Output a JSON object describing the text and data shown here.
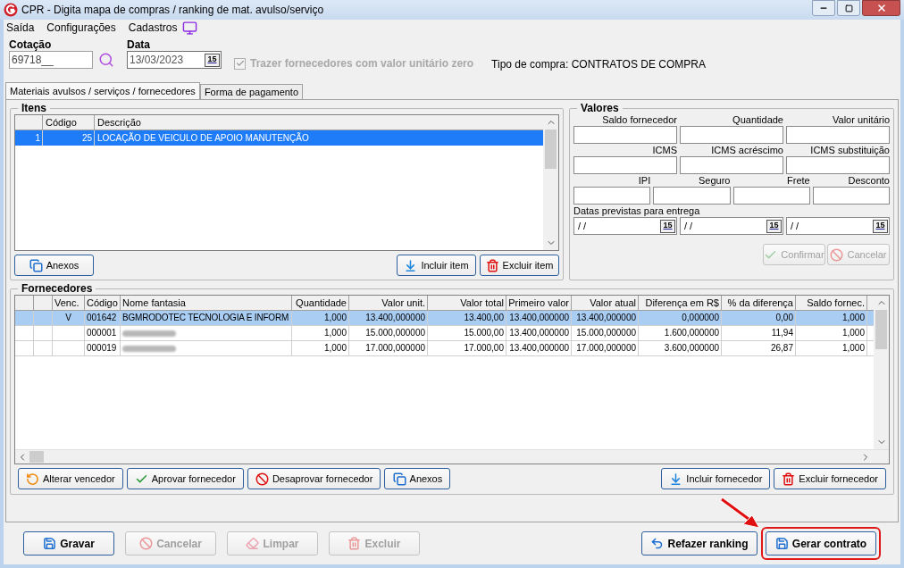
{
  "window": {
    "title": "CPR - Digita mapa de compras / ranking de mat. avulso/serviço"
  },
  "menu": [
    {
      "label": "Saída"
    },
    {
      "label": "Configurações"
    },
    {
      "label": "Cadastros"
    }
  ],
  "cotacao": {
    "label": "Cotação",
    "value": "69718__"
  },
  "data": {
    "label": "Data",
    "value": "13/03/2023",
    "calendar": "15"
  },
  "zero_option": {
    "label": "Trazer fornecedores com valor unitário zero",
    "checked": true,
    "disabled": true
  },
  "tipo_compra": "Tipo de compra: CONTRATOS DE COMPRA",
  "tabs": [
    {
      "label": "Materiais avulsos / serviços / fornecedores",
      "selected": true
    },
    {
      "label": "Forma de pagamento",
      "selected": false
    }
  ],
  "itens": {
    "title": "Itens",
    "columns": [
      "Código",
      "Descrição"
    ],
    "rows": [
      {
        "index": "1",
        "codigo": "25",
        "descricao": "LOCAÇÃO DE VEICULO DE APOIO MANUTENÇÃO",
        "selected": true
      }
    ],
    "buttons_left": [
      {
        "label": "Anexos",
        "kind": "attach",
        "disabled": false
      }
    ],
    "buttons_right": [
      {
        "label": "Incluir item",
        "kind": "add",
        "disabled": false
      },
      {
        "label": "Excluir item",
        "kind": "delete",
        "disabled": false
      }
    ]
  },
  "valores": {
    "title": "Valores",
    "field_rows": [
      [
        {
          "label": "Saldo fornecedor"
        },
        {
          "label": "Quantidade"
        },
        {
          "label": "Valor unitário"
        }
      ],
      [
        {
          "label": "ICMS"
        },
        {
          "label": "ICMS acréscimo"
        },
        {
          "label": "ICMS substituição"
        }
      ],
      [
        {
          "label": "IPI"
        },
        {
          "label": "Seguro"
        },
        {
          "label": "Frete"
        },
        {
          "label": "Desconto"
        }
      ]
    ],
    "dates_label": "Datas previstas para entrega",
    "dates": [
      {
        "value": "/ /",
        "calendar": "15"
      },
      {
        "value": "/ /",
        "calendar": "15"
      },
      {
        "value": "/ /",
        "calendar": "15"
      }
    ],
    "buttons": [
      {
        "label": "Confirmar",
        "kind": "confirm",
        "disabled": true
      },
      {
        "label": "Cancelar",
        "kind": "cancel",
        "disabled": true
      }
    ]
  },
  "fornecedores": {
    "title": "Fornecedores",
    "columns": [
      "Venc.",
      "Código",
      "Nome fantasia",
      "Quantidade",
      "Valor unit.",
      "Valor total",
      "Primeiro valor",
      "Valor atual",
      "Diferença em R$",
      "% da diferença",
      "Saldo fornec."
    ],
    "rows": [
      {
        "selected": true,
        "name_hidden": false,
        "venc": "V",
        "codigo": "001642",
        "nome": "BGMRODOTEC TECNOLOGIA E INFORM",
        "quantidade": "1,000",
        "valor_unit": "13.400,000000",
        "valor_total": "13.400,00",
        "primeiro_valor": "13.400,000000",
        "valor_atual": "13.400,000000",
        "diferenca": "0,000000",
        "pct_diferenca": "0,00",
        "saldo": "1,000"
      },
      {
        "selected": false,
        "name_hidden": true,
        "codigo": "000001",
        "quantidade": "1,000",
        "valor_unit": "15.000,000000",
        "valor_total": "15.000,00",
        "primeiro_valor": "13.400,000000",
        "valor_atual": "15.000,000000",
        "diferenca": "1.600,000000",
        "pct_diferenca": "11,94",
        "saldo": "1,000"
      },
      {
        "selected": false,
        "name_hidden": true,
        "codigo": "000019",
        "quantidade": "1,000",
        "valor_unit": "17.000,000000",
        "valor_total": "17.000,00",
        "primeiro_valor": "13.400,000000",
        "valor_atual": "17.000,000000",
        "diferenca": "3.600,000000",
        "pct_diferenca": "26,87",
        "saldo": "1,000"
      }
    ],
    "buttons_left": [
      {
        "label": "Alterar vencedor",
        "kind": "swap",
        "disabled": false
      },
      {
        "label": "Aprovar fornecedor",
        "kind": "confirm",
        "disabled": false
      },
      {
        "label": "Desaprovar fornecedor",
        "kind": "cancel",
        "disabled": false
      },
      {
        "label": "Anexos",
        "kind": "attach",
        "disabled": false
      }
    ],
    "buttons_right": [
      {
        "label": "Incluir fornecedor",
        "kind": "add",
        "disabled": false
      },
      {
        "label": "Excluir fornecedor",
        "kind": "delete",
        "disabled": false
      }
    ]
  },
  "bottom_left": [
    {
      "label": "Gravar",
      "kind": "save",
      "disabled": false
    },
    {
      "label": "Cancelar",
      "kind": "cancel",
      "disabled": true
    },
    {
      "label": "Limpar",
      "kind": "erase",
      "disabled": true
    },
    {
      "label": "Excluir",
      "kind": "delete",
      "disabled": true
    }
  ],
  "bottom_right": [
    {
      "label": "Refazer ranking",
      "kind": "redo",
      "disabled": false,
      "highlighted": false
    },
    {
      "label": "Gerar contrato",
      "kind": "save",
      "disabled": false,
      "highlighted": true
    }
  ]
}
